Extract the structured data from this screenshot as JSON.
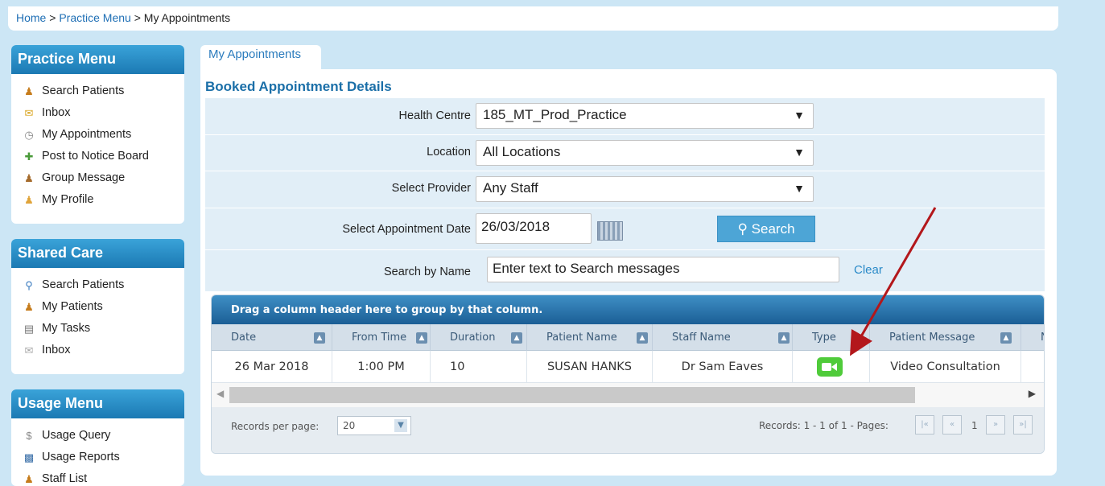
{
  "breadcrumb": {
    "home": "Home",
    "sep1": " > ",
    "practice": "Practice Menu",
    "sep2": " > ",
    "current": "My Appointments"
  },
  "sidebar": {
    "practice": {
      "title": "Practice Menu",
      "items": [
        {
          "label": "Search Patients",
          "icon": "people-icon"
        },
        {
          "label": "Inbox",
          "icon": "envelope-icon"
        },
        {
          "label": "My Appointments",
          "icon": "clock-icon"
        },
        {
          "label": "Post to Notice Board",
          "icon": "post-icon"
        },
        {
          "label": "Group Message",
          "icon": "group-icon"
        },
        {
          "label": "My Profile",
          "icon": "profile-icon"
        }
      ]
    },
    "shared": {
      "title": "Shared Care",
      "items": [
        {
          "label": "Search Patients",
          "icon": "search-user-icon"
        },
        {
          "label": "My Patients",
          "icon": "people-icon"
        },
        {
          "label": "My Tasks",
          "icon": "tasks-icon"
        },
        {
          "label": "Inbox",
          "icon": "envelope-icon"
        }
      ]
    },
    "usage": {
      "title": "Usage Menu",
      "items": [
        {
          "label": "Usage Query",
          "icon": "dollar-icon"
        },
        {
          "label": "Usage Reports",
          "icon": "chart-icon"
        },
        {
          "label": "Staff List",
          "icon": "staff-icon"
        }
      ]
    }
  },
  "tab": {
    "label": "My Appointments"
  },
  "section": {
    "title": "Booked Appointment Details"
  },
  "form": {
    "health_centre": {
      "label": "Health Centre",
      "value": "185_MT_Prod_Practice"
    },
    "location": {
      "label": "Location",
      "value": "All Locations"
    },
    "provider": {
      "label": "Select Provider",
      "value": "Any Staff"
    },
    "date": {
      "label": "Select Appointment Date",
      "value": "26/03/2018"
    },
    "search_button": "Search",
    "name": {
      "label": "Search by Name",
      "placeholder": "Enter text to Search messages"
    },
    "clear": "Clear"
  },
  "grid": {
    "group_hint": "Drag a column header here to group by that column.",
    "columns": [
      "Date",
      "From Time",
      "Duration",
      "Patient Name",
      "Staff Name",
      "Type",
      "Patient Message",
      "N"
    ],
    "rows": [
      {
        "date": "26 Mar 2018",
        "from_time": "1:00 PM",
        "duration": "10",
        "patient": "SUSAN HANKS",
        "staff": "Dr Sam Eaves",
        "type_icon": "video-camera-icon",
        "message": "Video Consultation"
      }
    ],
    "records_per_page_label": "Records per page:",
    "records_per_page": "20",
    "records_info": "Records: 1 - 1 of 1 - Pages:",
    "page": "1"
  },
  "annotation_color": "#b3171b"
}
